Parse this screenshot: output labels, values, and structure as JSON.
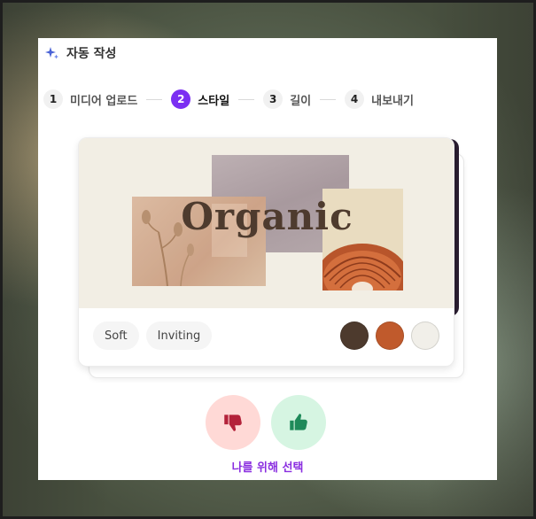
{
  "header": {
    "icon": "sparkle-icon",
    "title": "자동 작성"
  },
  "steps": [
    {
      "number": "1",
      "label": "미디어 업로드",
      "active": false
    },
    {
      "number": "2",
      "label": "스타일",
      "active": true
    },
    {
      "number": "3",
      "label": "길이",
      "active": false
    },
    {
      "number": "4",
      "label": "내보내기",
      "active": false
    }
  ],
  "style_card": {
    "preview_word": "Organic",
    "tags": [
      "Soft",
      "Inviting"
    ],
    "palette": [
      "#4d3a2d",
      "#c05a2c",
      "#f1efe9"
    ]
  },
  "feedback": {
    "dislike_icon": "thumbs-down-icon",
    "like_icon": "thumbs-up-icon",
    "pick_label": "나를 위해 선택"
  },
  "colors": {
    "accent": "#7b2ff2",
    "pick_text": "#8a2ee0",
    "dislike_bg": "#ffd9d6",
    "like_bg": "#d6f5e2"
  }
}
